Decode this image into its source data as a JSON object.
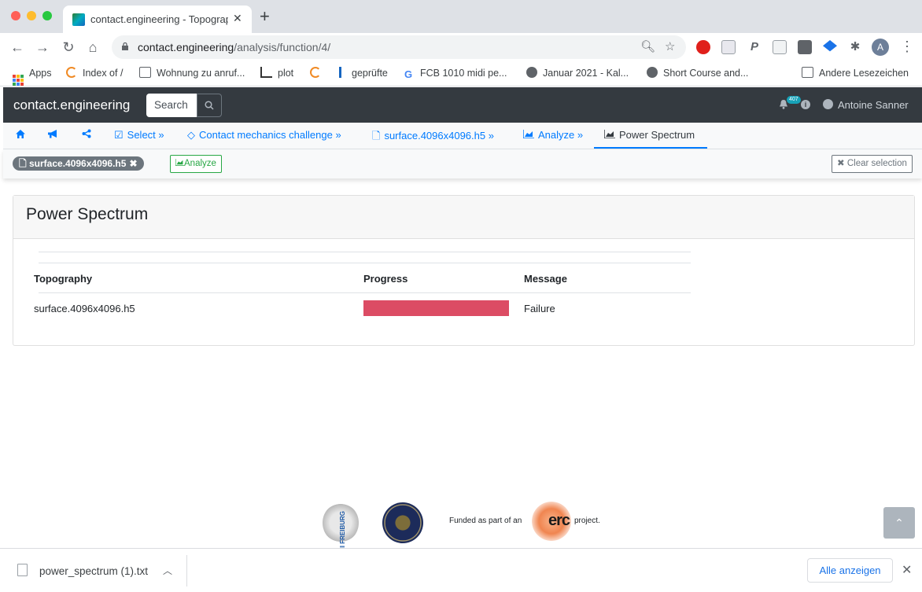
{
  "browser": {
    "tab_title": "contact.engineering - Topograp",
    "tab_close": "✕",
    "new_tab": "+",
    "url_host": "contact.engineering",
    "url_path": "/analysis/function/4/",
    "profile_initial": "A",
    "bookmarks": [
      {
        "label": "Apps",
        "icon": "apps-grid-icon"
      },
      {
        "label": "Index of /",
        "icon": "circle-arc-icon"
      },
      {
        "label": "Wohnung zu anruf...",
        "icon": "folder-icon"
      },
      {
        "label": "plot",
        "icon": "plot-icon"
      },
      {
        "label": "",
        "icon": "circle-arc-icon"
      },
      {
        "label": "geprüfte",
        "icon": "chart-icon"
      },
      {
        "label": "FCB 1010 midi pe...",
        "icon": "google-icon"
      },
      {
        "label": "Januar 2021 - Kal...",
        "icon": "globe-icon"
      },
      {
        "label": "Short Course and...",
        "icon": "globe-icon"
      },
      {
        "label": "Andere Lesezeichen",
        "icon": "folder-icon"
      }
    ]
  },
  "app": {
    "brand": "contact.engineering",
    "search_placeholder": "Search",
    "notification_count": "407",
    "user_name": "Antoine Sanner",
    "breadcrumbs": [
      {
        "label": "",
        "icon": "home-icon"
      },
      {
        "label": "",
        "icon": "megaphone-icon"
      },
      {
        "label": "",
        "icon": "share-icon"
      },
      {
        "label": "Select",
        "icon": "check-square-icon",
        "suffix": "»"
      },
      {
        "label": "Contact mechanics challenge",
        "icon": "diamond-icon",
        "suffix": "»"
      },
      {
        "label": "surface.4096x4096.h5",
        "icon": "file-icon",
        "suffix": "»"
      },
      {
        "label": "Analyze",
        "icon": "area-chart-icon",
        "suffix": "»"
      },
      {
        "label": "Power Spectrum",
        "icon": "area-chart-icon",
        "suffix": ""
      }
    ],
    "selection": {
      "pill_label": "surface.4096x4096.h5",
      "pill_close": "✖",
      "analyze_label": "Analyze",
      "clear_label": "Clear selection"
    }
  },
  "card": {
    "title": "Power Spectrum",
    "columns": [
      "Topography",
      "Progress",
      "Message"
    ],
    "rows": [
      {
        "topography": "surface.4096x4096.h5",
        "progress": 1.0,
        "message": "Failure"
      }
    ],
    "progress_color": "#dc4c64"
  },
  "footer": {
    "uni_text": "UNI FREIBURG",
    "funded_text": "Funded as part of an",
    "erc_text": "erc",
    "project_text": "project.",
    "scroll_top": "⌃"
  },
  "downloads": {
    "file_name": "power_spectrum (1).txt",
    "show_all": "Alle anzeigen",
    "close": "✕"
  }
}
